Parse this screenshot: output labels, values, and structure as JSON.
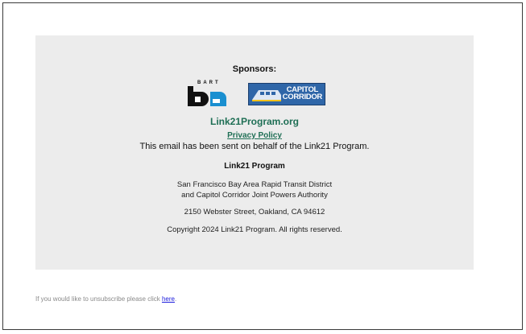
{
  "footer": {
    "sponsors_heading": "Sponsors:",
    "logos": {
      "bart": {
        "small_text": "BART",
        "icon": "bart-logo-icon"
      },
      "capitol_corridor": {
        "line1": "CAPITOL",
        "line2": "CORRIDOR",
        "icon": "capitol-corridor-logo-icon"
      }
    },
    "site_link": "Link21Program.org",
    "privacy_link": "Privacy Policy",
    "behalf_text": "This email has been sent on behalf of the Link21 Program.",
    "org_name": "Link21 Program",
    "org_line1": "San Francisco Bay Area Rapid Transit District",
    "org_line2": "and Capitol Corridor Joint Powers Authority",
    "address": "2150 Webster Street, Oakland, CA 94612",
    "copyright": "Copyright 2024 Link21 Program. All rights reserved."
  },
  "unsubscribe": {
    "text": "If you would like to unsubscribe please click ",
    "link": "here",
    "trailing": "."
  },
  "colors": {
    "panel_bg": "#ececec",
    "link_green": "#1f6f55",
    "unsubscribe_link": "#1a1adc",
    "capitol_blue": "#2f66a8"
  }
}
